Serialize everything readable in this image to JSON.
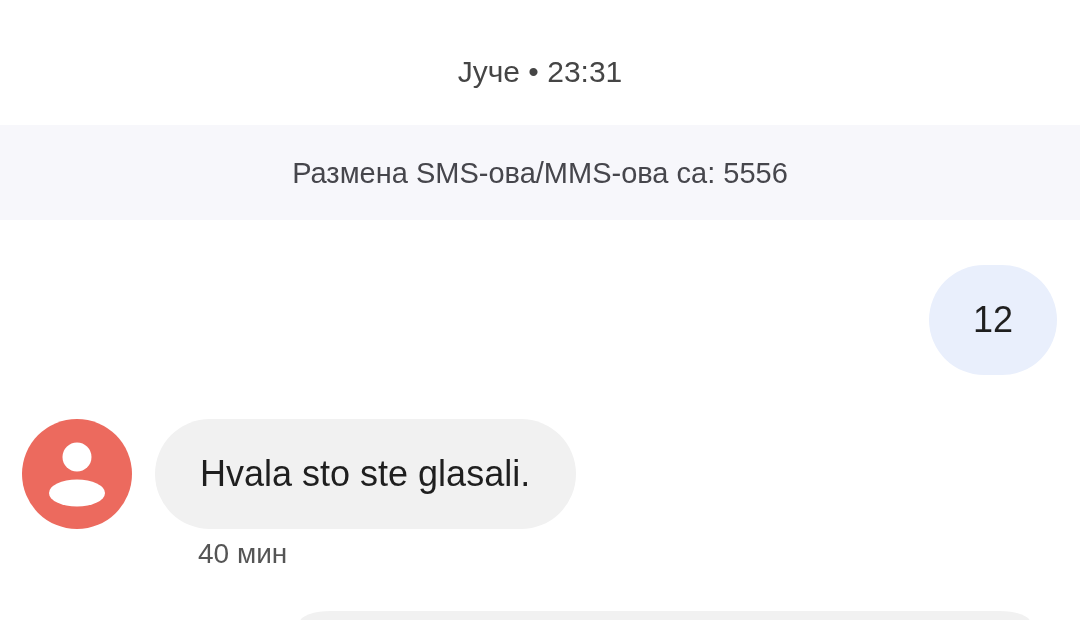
{
  "date_header": "Јуче • 23:31",
  "sms_banner": "Размена SMS-ова/MMS-ова са: 5556",
  "messages": [
    {
      "kind": "outgoing",
      "text": "12"
    },
    {
      "kind": "incoming",
      "text": "Hvala sto ste glasali.",
      "time": "40 мин"
    },
    {
      "kind": "clipped"
    }
  ]
}
